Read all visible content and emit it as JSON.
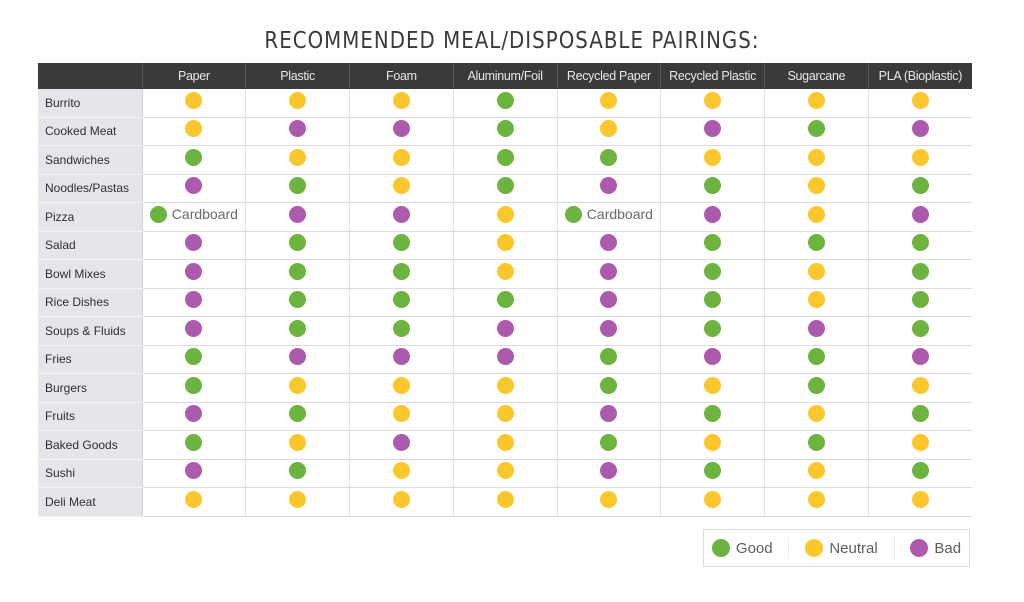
{
  "title": "RECOMMENDED MEAL/DISPOSABLE PAIRINGS:",
  "colors": {
    "good": "#6cb33f",
    "neutral": "#fcc62d",
    "bad": "#ac5bac"
  },
  "legend": [
    {
      "key": "good",
      "label": "Good"
    },
    {
      "key": "neutral",
      "label": "Neutral"
    },
    {
      "key": "bad",
      "label": "Bad"
    }
  ],
  "chart_data": {
    "type": "table",
    "title": "RECOMMENDED MEAL/DISPOSABLE PAIRINGS:",
    "columns": [
      "Paper",
      "Plastic",
      "Foam",
      "Aluminum/Foil",
      "Recycled Paper",
      "Recycled Plastic",
      "Sugarcane",
      "PLA (Bioplastic)"
    ],
    "rows": [
      {
        "meal": "Burrito",
        "ratings": [
          "neutral",
          "neutral",
          "neutral",
          "good",
          "neutral",
          "neutral",
          "neutral",
          "neutral"
        ]
      },
      {
        "meal": "Cooked Meat",
        "ratings": [
          "neutral",
          "bad",
          "bad",
          "good",
          "neutral",
          "bad",
          "good",
          "bad"
        ]
      },
      {
        "meal": "Sandwiches",
        "ratings": [
          "good",
          "neutral",
          "neutral",
          "good",
          "good",
          "neutral",
          "neutral",
          "neutral"
        ]
      },
      {
        "meal": "Noodles/Pastas",
        "ratings": [
          "bad",
          "good",
          "neutral",
          "good",
          "bad",
          "good",
          "neutral",
          "good"
        ]
      },
      {
        "meal": "Pizza",
        "ratings": [
          "good",
          "bad",
          "bad",
          "neutral",
          "good",
          "bad",
          "neutral",
          "bad"
        ],
        "notes": [
          "Cardboard",
          "",
          "",
          "",
          "Cardboard",
          "",
          "",
          ""
        ]
      },
      {
        "meal": "Salad",
        "ratings": [
          "bad",
          "good",
          "good",
          "neutral",
          "bad",
          "good",
          "good",
          "good"
        ]
      },
      {
        "meal": "Bowl Mixes",
        "ratings": [
          "bad",
          "good",
          "good",
          "neutral",
          "bad",
          "good",
          "neutral",
          "good"
        ]
      },
      {
        "meal": "Rice Dishes",
        "ratings": [
          "bad",
          "good",
          "good",
          "good",
          "bad",
          "good",
          "neutral",
          "good"
        ]
      },
      {
        "meal": "Soups & Fluids",
        "ratings": [
          "bad",
          "good",
          "good",
          "bad",
          "bad",
          "good",
          "bad",
          "good"
        ]
      },
      {
        "meal": "Fries",
        "ratings": [
          "good",
          "bad",
          "bad",
          "bad",
          "good",
          "bad",
          "good",
          "bad"
        ]
      },
      {
        "meal": "Burgers",
        "ratings": [
          "good",
          "neutral",
          "neutral",
          "neutral",
          "good",
          "neutral",
          "good",
          "neutral"
        ]
      },
      {
        "meal": "Fruits",
        "ratings": [
          "bad",
          "good",
          "neutral",
          "neutral",
          "bad",
          "good",
          "neutral",
          "good"
        ]
      },
      {
        "meal": "Baked Goods",
        "ratings": [
          "good",
          "neutral",
          "bad",
          "neutral",
          "good",
          "neutral",
          "good",
          "neutral"
        ]
      },
      {
        "meal": "Sushi",
        "ratings": [
          "bad",
          "good",
          "neutral",
          "neutral",
          "bad",
          "good",
          "neutral",
          "good"
        ]
      },
      {
        "meal": "Deli Meat",
        "ratings": [
          "neutral",
          "neutral",
          "neutral",
          "neutral",
          "neutral",
          "neutral",
          "neutral",
          "neutral"
        ]
      }
    ],
    "legend": [
      "Good",
      "Neutral",
      "Bad"
    ],
    "legend_position": "bottom-right"
  }
}
